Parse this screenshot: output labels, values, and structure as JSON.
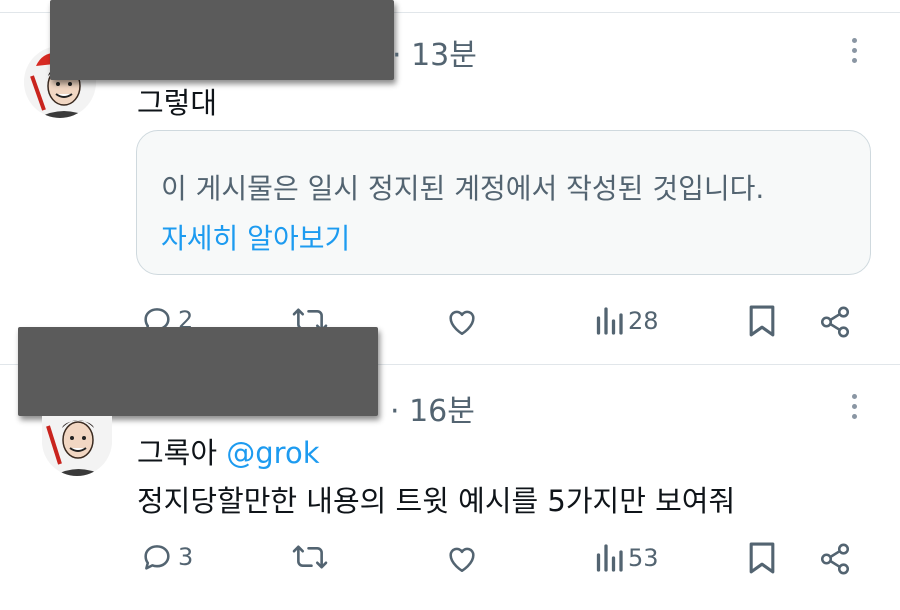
{
  "post1": {
    "time": "· 13분",
    "text": "그렇대",
    "notice_text": "이 게시물은 일시 정지된 계정에서 작성된 것입니다.",
    "notice_link": "자세히 알아보기",
    "actions": {
      "reply_count": "2",
      "views_count": "28"
    }
  },
  "post2": {
    "time": "· 16분",
    "author_name": "그록아",
    "mention": "@grok",
    "text": "정지당할만한 내용의 트윗 예시를 5가지만 보여줘",
    "actions": {
      "reply_count": "3",
      "views_count": "53"
    }
  },
  "colors": {
    "link": "#1d9bf0",
    "muted": "#536471",
    "text": "#0f1419",
    "redaction": "#5b5b5b"
  },
  "icons": [
    "more-icon",
    "reply-icon",
    "retweet-icon",
    "like-icon",
    "views-icon",
    "bookmark-icon",
    "share-icon"
  ]
}
